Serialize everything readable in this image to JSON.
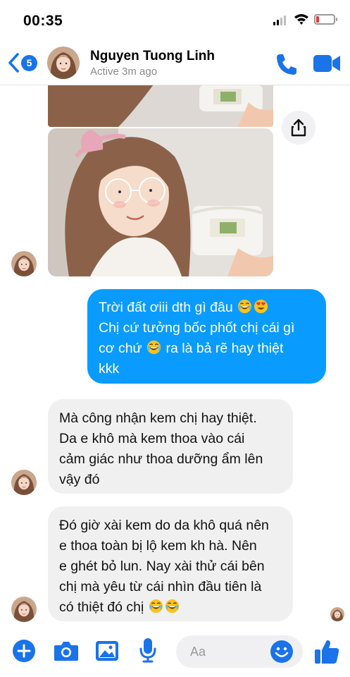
{
  "status_bar": {
    "time": "00:35",
    "battery_level": 0.15,
    "icons": [
      "signal-icon",
      "wifi-icon",
      "battery-icon"
    ]
  },
  "header": {
    "back_badge": "5",
    "contact_name": "Nguyen Tuong Linh",
    "contact_status": "Active 3m ago",
    "icons": [
      "back-chevron-icon",
      "phone-icon",
      "video-camera-icon"
    ]
  },
  "messages": [
    {
      "type": "image",
      "sender": "contact",
      "description_icon": "photo-image",
      "action_icon": "share-icon"
    },
    {
      "type": "text",
      "sender": "me",
      "lines": [
        {
          "text": "Trời đất ơiii dth gì đâu",
          "emojis": [
            "laughing-emoji",
            "heart-eyes-emoji"
          ]
        },
        {
          "text": "Chị cứ tưởng bốc phốt chị cái gì",
          "emojis": []
        },
        {
          "text_before": "cơ chứ",
          "text_after": "ra là bả rẽ hay thiệt",
          "emojis": [
            "laughing-emoji"
          ]
        },
        {
          "text": "kkk",
          "emojis": []
        }
      ]
    },
    {
      "type": "text",
      "sender": "contact",
      "lines": [
        {
          "text": "Mà công nhận kem chị hay thiệt."
        },
        {
          "text": "Da e khô mà kem thoa vào cái"
        },
        {
          "text": "cảm giác như thoa dưỡng ẩm lên"
        },
        {
          "text": "vậy đó"
        }
      ]
    },
    {
      "type": "text",
      "sender": "contact",
      "lines": [
        {
          "text": "Đó giờ xài kem do da khô quá nên"
        },
        {
          "text": "e thoa toàn bị lộ kem kh hà. Nên"
        },
        {
          "text": "e ghét bỏ lun. Nay xài thử cái bên"
        },
        {
          "text": "chị mà yêu từ cái nhìn đầu tiên là"
        },
        {
          "text": "có thiệt đó chị",
          "emojis": [
            "laughing-emoji",
            "laughing-emoji"
          ]
        }
      ]
    }
  ],
  "composer": {
    "placeholder": "Aa",
    "icons": [
      "plus-icon",
      "camera-icon",
      "gallery-icon",
      "microphone-icon",
      "smiley-icon",
      "thumbs-up-icon"
    ]
  },
  "colors": {
    "accent": "#0a9bff",
    "brand_blue": "#1a73e8",
    "incoming_bubble": "#f0f0f0",
    "badge": "#1a73e8"
  }
}
